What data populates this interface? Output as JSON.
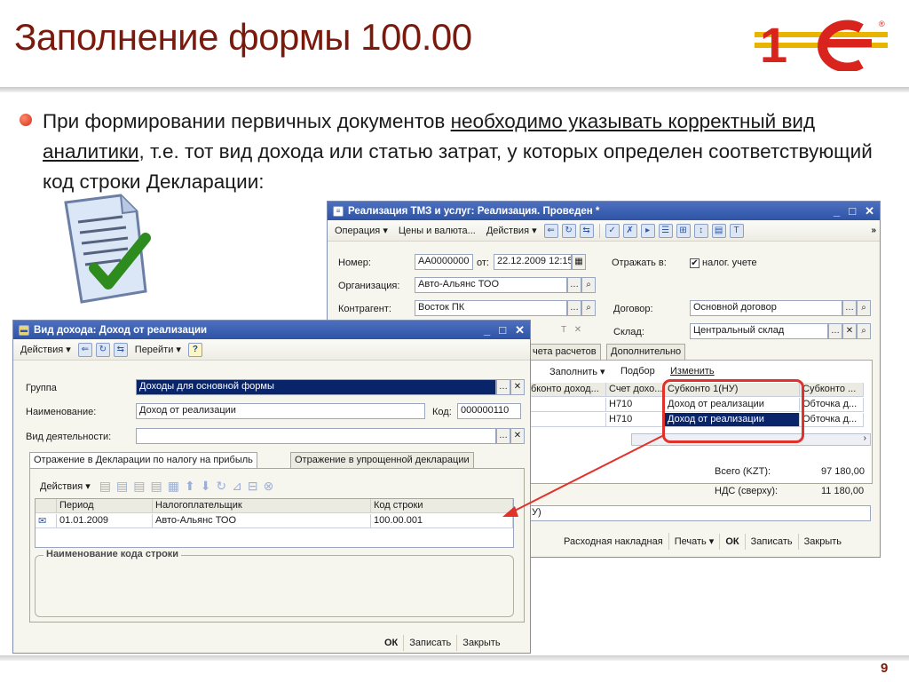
{
  "slide": {
    "title": "Заполнение формы 100.00",
    "bullet_part1": "При формировании первичных документов ",
    "bullet_underlined": "необходимо указывать корректный вид аналитики",
    "bullet_part2": ", т.е. тот вид дохода или статью затрат, у которых определен соответствующий код строки Декларации:",
    "page_number": "9",
    "logo_text": "1С"
  },
  "back_window": {
    "title": "Реализация ТМЗ и услуг: Реализация. Проведен *",
    "toolbar": [
      "Операция ▾",
      "Цены и валюта...",
      "Действия ▾"
    ],
    "nomer_label": "Номер:",
    "nomer_value": "АА0000000",
    "ot_label": "от:",
    "date_value": "22.12.2009 12:15:",
    "otrazhat_label": "Отражать в:",
    "nalog_checkbox": "налог. учете",
    "org_label": "Организация:",
    "org_value": "Авто-Альянс ТОО",
    "kontragent_label": "Контрагент:",
    "kontragent_value": "Восток ПК",
    "dogovor_label": "Договор:",
    "dogovor_value": "Основной договор",
    "sklad_label": "Склад:",
    "sklad_value": "Центральный склад",
    "tabs": [
      "чета расчетов",
      "Дополнительно"
    ],
    "inner_toolbar": [
      "Заполнить ▾",
      "Подбор",
      "Изменить"
    ],
    "grid_headers": [
      "бконто доход...",
      "Счет дохо...",
      "Субконто 1(НУ)",
      "Субконто ..."
    ],
    "grid_rows": [
      [
        "",
        "Н710",
        "Доход от реализации",
        "Обточка д..."
      ],
      [
        "",
        "Н710",
        "Доход от реализации",
        "Обточка д..."
      ]
    ],
    "total_label": "Всего (KZT):",
    "total_value": "97 180,00",
    "nds_label": "НДС (сверху):",
    "nds_value": "11 180,00",
    "comment_tail": "У)",
    "bottom_buttons": [
      "Расходная накладная",
      "Печать ▾",
      "ОК",
      "Записать",
      "Закрыть"
    ]
  },
  "front_window": {
    "title": "Вид дохода: Доход от реализации",
    "toolbar": [
      "Действия ▾",
      "Перейти ▾"
    ],
    "gruppa_label": "Группа",
    "gruppa_value": "Доходы для основной формы",
    "naim_label": "Наименование:",
    "naim_value": "Доход от реализации",
    "kod_label": "Код:",
    "kod_value": "000000110",
    "vid_label": "Вид деятельности:",
    "vid_value": "",
    "tabs": [
      "Отражение в Декларации по налогу на прибыль",
      "Отражение в упрощенной декларации"
    ],
    "inner_toolbar_label": "Действия ▾",
    "grid_headers": [
      "Период",
      "Налогоплательщик",
      "Код строки"
    ],
    "grid_rows": [
      [
        "01.01.2009",
        "Авто-Альянс ТОО",
        "100.00.001"
      ]
    ],
    "group_title": "Наименование кода строки",
    "bottom_buttons": [
      "ОК",
      "Записать",
      "Закрыть"
    ]
  },
  "colors": {
    "highlight_box": "#e0322a",
    "arrow": "#e0322a",
    "selected_row": "#0a246a"
  }
}
